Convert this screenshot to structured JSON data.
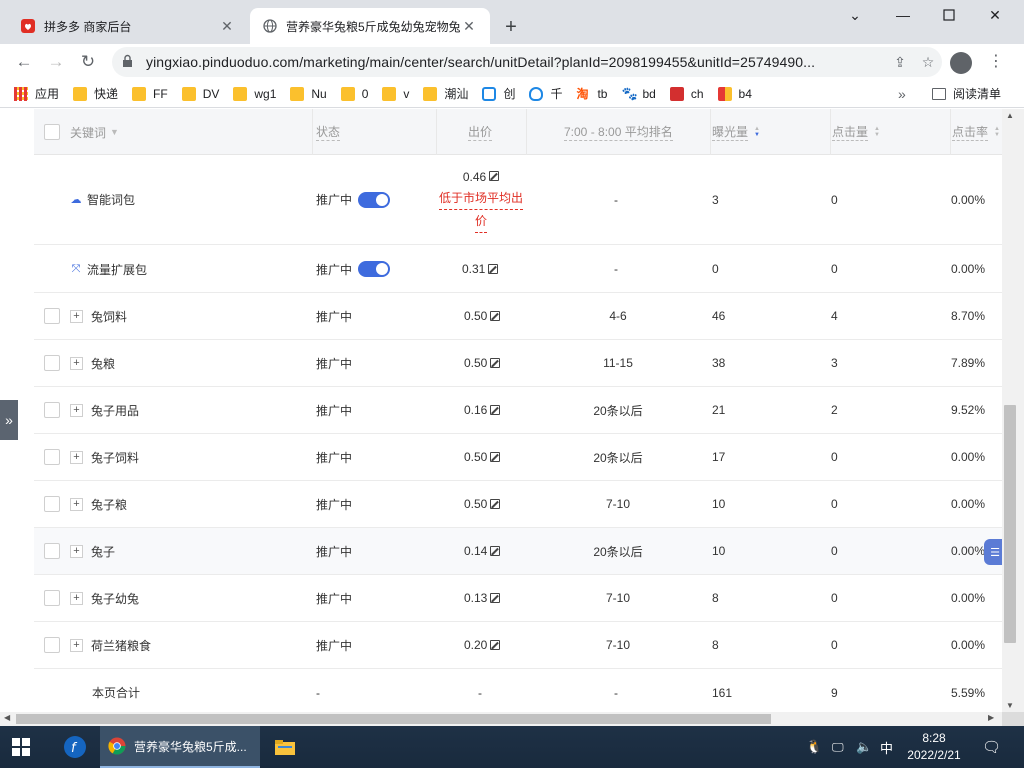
{
  "browser": {
    "tabs": [
      {
        "title": "拼多多 商家后台",
        "active": false
      },
      {
        "title": "营养豪华兔粮5斤成兔幼兔宠物兔",
        "active": true
      }
    ],
    "new_tab": "+",
    "url": "yingxiao.pinduoduo.com/marketing/main/center/search/unitDetail?planId=2098199455&unitId=25749490..."
  },
  "bookmarks": [
    {
      "label": "应用",
      "icon": "apps-icon"
    },
    {
      "label": "快递",
      "icon": "folder-icon"
    },
    {
      "label": "FF",
      "icon": "folder-icon"
    },
    {
      "label": "DV",
      "icon": "folder-icon"
    },
    {
      "label": "wg1",
      "icon": "folder-icon"
    },
    {
      "label": "Nu",
      "icon": "folder-icon"
    },
    {
      "label": "0",
      "icon": "folder-icon"
    },
    {
      "label": "v",
      "icon": "folder-icon"
    },
    {
      "label": "潮汕",
      "icon": "folder-icon"
    },
    {
      "label": "创",
      "icon": "bilibili-icon"
    },
    {
      "label": "千",
      "icon": "qianniu-icon"
    },
    {
      "label": "tb",
      "icon": "taobao-icon"
    },
    {
      "label": "bd",
      "icon": "baidu-icon"
    },
    {
      "label": "ch",
      "icon": "ch-icon"
    },
    {
      "label": "b4",
      "icon": "bag-icon"
    }
  ],
  "bookmarks_more": "»",
  "reading_list": "阅读清单",
  "table": {
    "headers": {
      "keyword": "关键词",
      "status": "状态",
      "bid": "出价",
      "rank": "7:00 - 8:00 平均排名",
      "impressions": "曝光量",
      "clicks": "点击量",
      "ctr": "点击率"
    },
    "packages": [
      {
        "name": "智能词包",
        "icon": "cloud-icon",
        "status": "推广中",
        "bid": "0.46",
        "bid_warning": [
          "低于市场平均出",
          "价"
        ],
        "rank": "-",
        "impressions": "3",
        "clicks": "0",
        "ctr": "0.00%"
      },
      {
        "name": "流量扩展包",
        "icon": "expand-icon",
        "status": "推广中",
        "bid": "0.31",
        "rank": "-",
        "impressions": "0",
        "clicks": "0",
        "ctr": "0.00%"
      }
    ],
    "rows": [
      {
        "keyword": "兔饲料",
        "status": "推广中",
        "bid": "0.50",
        "rank": "4-6",
        "impressions": "46",
        "clicks": "4",
        "ctr": "8.70%"
      },
      {
        "keyword": "兔粮",
        "status": "推广中",
        "bid": "0.50",
        "rank": "11-15",
        "impressions": "38",
        "clicks": "3",
        "ctr": "7.89%"
      },
      {
        "keyword": "兔子用品",
        "status": "推广中",
        "bid": "0.16",
        "rank": "20条以后",
        "impressions": "21",
        "clicks": "2",
        "ctr": "9.52%"
      },
      {
        "keyword": "兔子饲料",
        "status": "推广中",
        "bid": "0.50",
        "rank": "20条以后",
        "impressions": "17",
        "clicks": "0",
        "ctr": "0.00%"
      },
      {
        "keyword": "兔子粮",
        "status": "推广中",
        "bid": "0.50",
        "rank": "7-10",
        "impressions": "10",
        "clicks": "0",
        "ctr": "0.00%"
      },
      {
        "keyword": "兔子",
        "status": "推广中",
        "bid": "0.14",
        "rank": "20条以后",
        "impressions": "10",
        "clicks": "0",
        "ctr": "0.00%"
      },
      {
        "keyword": "兔子幼兔",
        "status": "推广中",
        "bid": "0.13",
        "rank": "7-10",
        "impressions": "8",
        "clicks": "0",
        "ctr": "0.00%"
      },
      {
        "keyword": "荷兰猪粮食",
        "status": "推广中",
        "bid": "0.20",
        "rank": "7-10",
        "impressions": "8",
        "clicks": "0",
        "ctr": "0.00%"
      }
    ],
    "total": {
      "label": "本页合计",
      "status": "-",
      "bid": "-",
      "rank": "-",
      "impressions": "161",
      "clicks": "9",
      "ctr": "5.59%"
    }
  },
  "sidebar_toggle": "»",
  "taskbar": {
    "chrome_title": "营养豪华兔粮5斤成...",
    "ime": "中",
    "time": "8:28",
    "date": "2022/2/21"
  }
}
